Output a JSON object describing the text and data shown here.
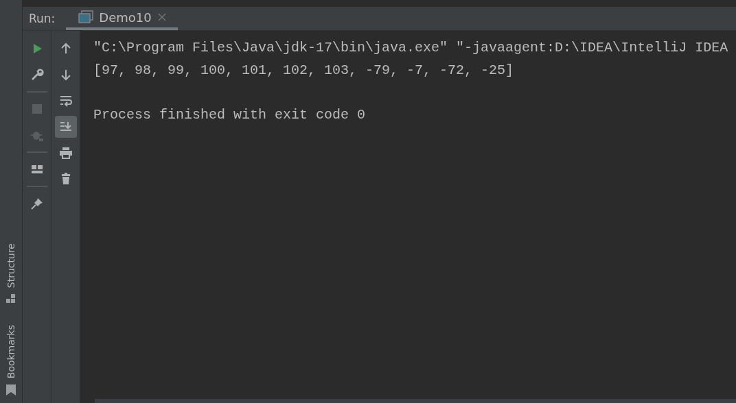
{
  "side_tabs": [
    {
      "label": "Structure",
      "kind": "structure"
    },
    {
      "label": "Bookmarks",
      "kind": "bookmarks"
    }
  ],
  "run_panel": {
    "label": "Run:",
    "tab": {
      "title": "Demo10",
      "selected": true
    }
  },
  "toolbar_primary": [
    {
      "kind": "run",
      "disabled": false
    },
    {
      "kind": "wrench",
      "disabled": false
    },
    {
      "kind": "stop",
      "disabled": true
    },
    {
      "kind": "debug",
      "disabled": true
    },
    {
      "kind": "layout",
      "disabled": false
    },
    {
      "kind": "pin",
      "disabled": false
    }
  ],
  "toolbar_secondary": [
    {
      "kind": "up",
      "on": false
    },
    {
      "kind": "down",
      "on": false
    },
    {
      "kind": "wrap",
      "on": false
    },
    {
      "kind": "scroll",
      "on": true
    },
    {
      "kind": "print",
      "on": false
    },
    {
      "kind": "trash",
      "on": false
    }
  ],
  "console": {
    "lines": [
      "\"C:\\Program Files\\Java\\jdk-17\\bin\\java.exe\" \"-javaagent:D:\\IDEA\\IntelliJ IDEA",
      "[97, 98, 99, 100, 101, 102, 103, -79, -7, -72, -25]"
    ],
    "exit_message": "Process finished with exit code 0"
  }
}
